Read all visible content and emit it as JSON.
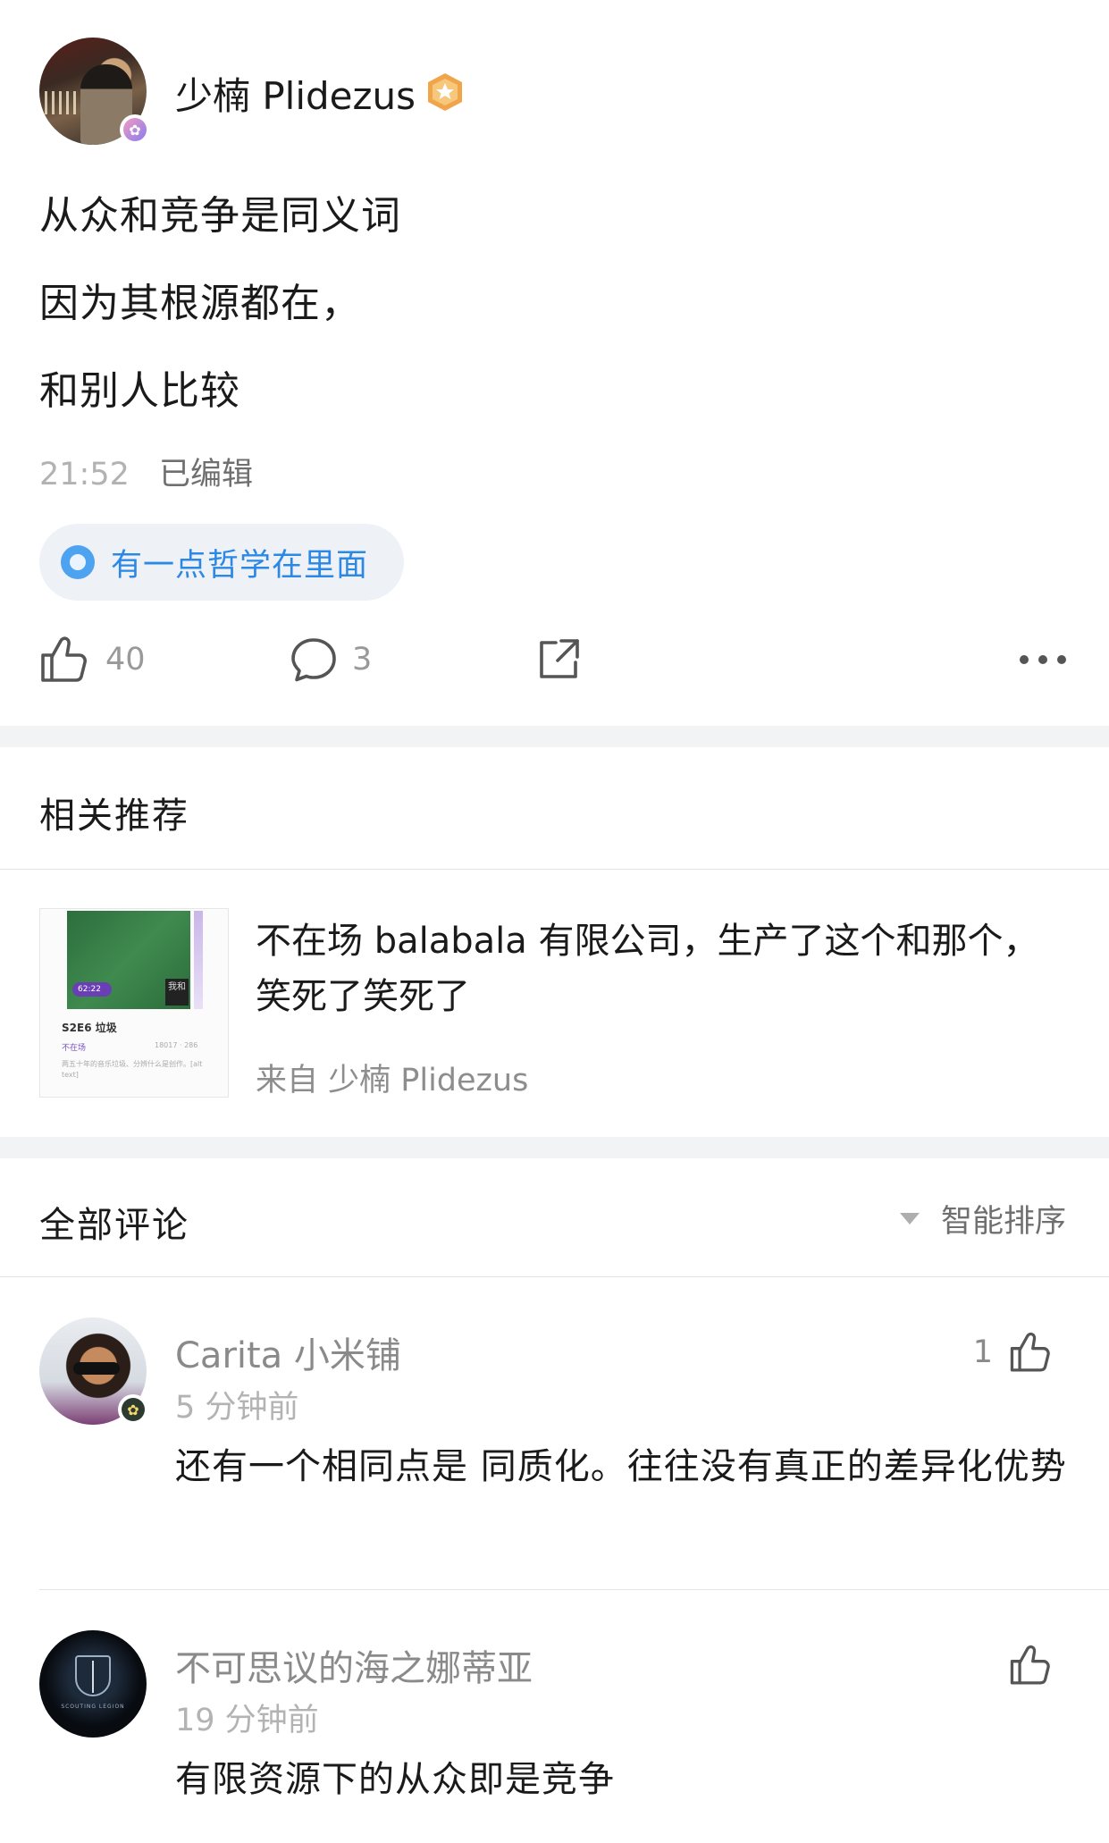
{
  "post": {
    "author": "少楠 Plidezus",
    "lines": [
      "从众和竞争是同义词",
      "因为其根源都在，",
      "和别人比较"
    ],
    "time": "21:52",
    "edited": "已编辑",
    "tag": "有一点哲学在里面",
    "likes": "40",
    "comments": "3"
  },
  "related": {
    "title": "相关推荐",
    "item": {
      "title": "不在场 balabala 有限公司，生产了这个和那个，笑死了笑死了",
      "source": "来自 少楠 Plidezus",
      "thumb": {
        "play_label": "62:22",
        "episode": "S2E6 垃圾",
        "show": "不在场",
        "stats": "18017 · 286",
        "desc": "两五十年的音乐垃圾、分辨什么是创作。[alt text]",
        "art": "我和"
      }
    }
  },
  "comments_section": {
    "title": "全部评论",
    "sort_label": "智能排序"
  },
  "comments": [
    {
      "name": "Carita 小米铺",
      "time": "5 分钟前",
      "text": "还有一个相同点是 同质化。往往没有真正的差异化优势",
      "likes": "1"
    },
    {
      "name": "不可思议的海之娜蒂亚",
      "time": "19 分钟前",
      "text": "有限资源下的从众即是竞争",
      "likes": "",
      "avatar_caption": "SCOUTING LEGION"
    }
  ],
  "colors": {
    "accent_blue": "#2c88e5",
    "badge_orange": "#f0a54a",
    "divider": "#f2f3f5"
  },
  "icons": [
    "like-icon",
    "comment-icon",
    "share-icon",
    "more-icon",
    "vip-badge-icon",
    "flower-badge-icon",
    "sort-caret-icon"
  ]
}
